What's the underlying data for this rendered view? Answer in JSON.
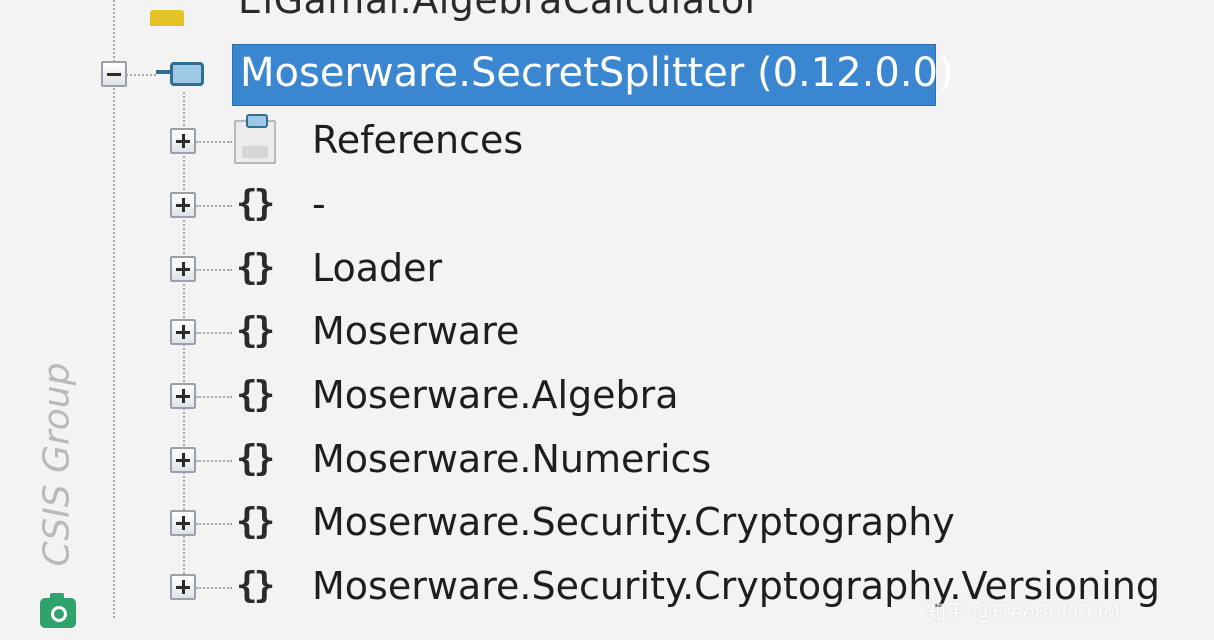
{
  "tree": {
    "cropped_row": {
      "icon": "warning-icon",
      "label": "ElGamal.AlgebraCalculator"
    },
    "assembly": {
      "label": "Moserware.SecretSplitter (0.12.0.0)",
      "icon": "assembly-icon",
      "expanded": true,
      "selected": true,
      "selection_color": "#3a86d0"
    },
    "children": [
      {
        "label": "References",
        "icon": "references-icon",
        "expanded": false
      },
      {
        "label": "-",
        "icon": "namespace-icon",
        "expanded": false
      },
      {
        "label": "Loader",
        "icon": "namespace-icon",
        "expanded": false
      },
      {
        "label": "Moserware",
        "icon": "namespace-icon",
        "expanded": false
      },
      {
        "label": "Moserware.Algebra",
        "icon": "namespace-icon",
        "expanded": false
      },
      {
        "label": "Moserware.Numerics",
        "icon": "namespace-icon",
        "expanded": false
      },
      {
        "label": "Moserware.Security.Cryptography",
        "icon": "namespace-icon",
        "expanded": false
      },
      {
        "label": "Moserware.Security.Cryptography.Versioning",
        "icon": "namespace-icon",
        "expanded": false
      }
    ],
    "namespace_icon_glyph": "{}"
  },
  "watermark": {
    "side_text": "CSIS Group",
    "corner_text": "知乎 @FreeBuf.COM",
    "camera_icon": "camera-icon"
  }
}
